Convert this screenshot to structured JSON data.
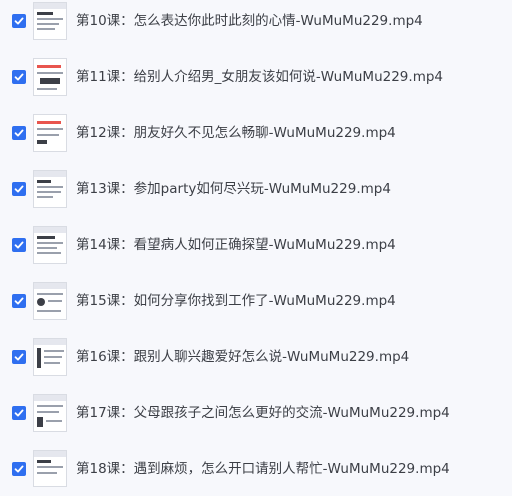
{
  "files": [
    {
      "name": "第10课：怎么表达你此时此刻的心情-WuMuMu229.mp4",
      "checked": true,
      "thumb": "video-thumbnail"
    },
    {
      "name": "第11课：给别人介绍男_女朋友该如何说-WuMuMu229.mp4",
      "checked": true,
      "thumb": "video-thumbnail"
    },
    {
      "name": "第12课：朋友好久不见怎么畅聊-WuMuMu229.mp4",
      "checked": true,
      "thumb": "video-thumbnail"
    },
    {
      "name": "第13课：参加party如何尽兴玩-WuMuMu229.mp4",
      "checked": true,
      "thumb": "video-thumbnail"
    },
    {
      "name": "第14课：看望病人如何正确探望-WuMuMu229.mp4",
      "checked": true,
      "thumb": "video-thumbnail"
    },
    {
      "name": "第15课：如何分享你找到工作了-WuMuMu229.mp4",
      "checked": true,
      "thumb": "video-thumbnail"
    },
    {
      "name": "第16课：跟别人聊兴趣爱好怎么说-WuMuMu229.mp4",
      "checked": true,
      "thumb": "video-thumbnail"
    },
    {
      "name": "第17课：父母跟孩子之间怎么更好的交流-WuMuMu229.mp4",
      "checked": true,
      "thumb": "video-thumbnail"
    },
    {
      "name": "第18课：遇到麻烦，怎么开口请别人帮忙-WuMuMu229.mp4",
      "checked": true,
      "thumb": "video-thumbnail"
    }
  ],
  "colors": {
    "checkbox": "#2f6ff0",
    "text": "#3c3f46",
    "background": "#f7f8fc"
  }
}
